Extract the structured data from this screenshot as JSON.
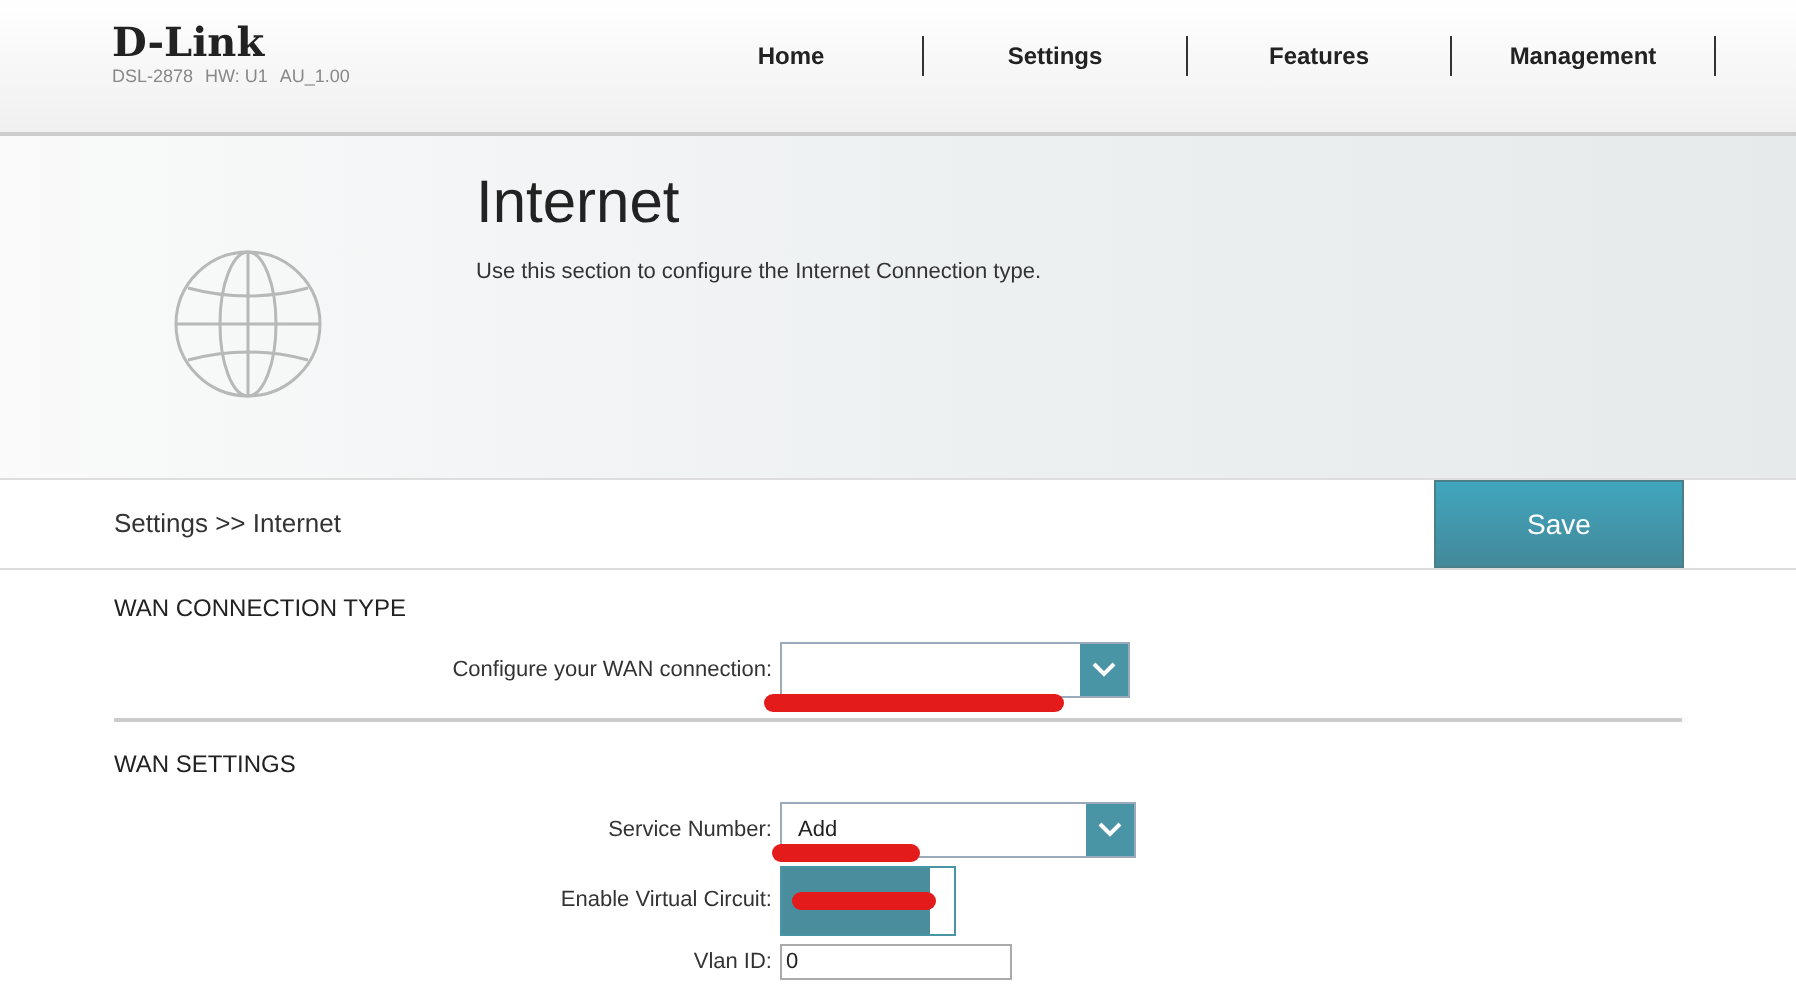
{
  "header": {
    "logo": "D-Link",
    "model": "DSL-2878",
    "hardware": "HW: U1",
    "firmware": "AU_1.00"
  },
  "nav": [
    {
      "label": "Home",
      "selected": false
    },
    {
      "label": "Settings",
      "selected": false
    },
    {
      "label": "Features",
      "selected": false
    },
    {
      "label": "Management",
      "selected": false
    }
  ],
  "banner": {
    "title": "Internet",
    "description": "Use this section to configure the Internet Connection type."
  },
  "breadcrumb": "Settings >> Internet",
  "save_button": "Save",
  "sections": [
    {
      "title": "WAN CONNECTION TYPE",
      "fields": [
        {
          "kind": "select",
          "label": "Configure your WAN connection:",
          "redacted": true
        }
      ]
    },
    {
      "title": "WAN SETTINGS",
      "fields": [
        {
          "kind": "select",
          "label": "Service Number:",
          "value": "Add",
          "redacted": true
        },
        {
          "kind": "toggle",
          "label": "Enable Virtual Circuit:",
          "on": true,
          "redacted": true
        },
        {
          "kind": "text",
          "label": "Vlan ID:",
          "value": "0"
        }
      ]
    }
  ]
}
